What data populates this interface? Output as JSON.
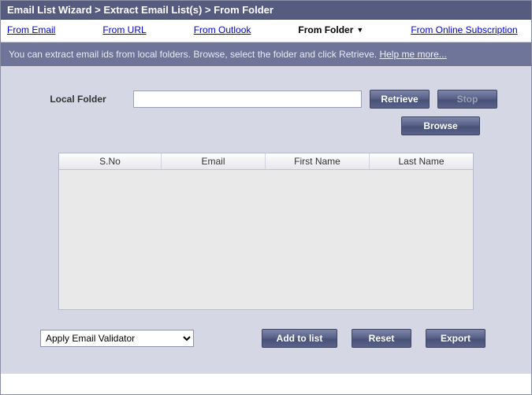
{
  "titlebar": {
    "text": "Email List Wizard > Extract Email List(s) > From Folder"
  },
  "tabs": {
    "from_email": "From Email",
    "from_url": "From URL",
    "from_outlook": "From Outlook",
    "from_folder": "From Folder",
    "from_online": "From Online Subscription"
  },
  "infobar": {
    "text": "You can extract email ids from local folders. Browse, select the folder and click Retrieve. ",
    "help": "Help me more..."
  },
  "form": {
    "local_folder_label": "Local Folder",
    "path_value": "",
    "retrieve": "Retrieve",
    "stop": "Stop",
    "browse": "Browse"
  },
  "table": {
    "headers": {
      "sno": "S.No",
      "email": "Email",
      "first_name": "First Name",
      "last_name": "Last Name"
    },
    "rows": []
  },
  "actions": {
    "validator_selected": "Apply Email Validator",
    "add_to_list": "Add to list",
    "reset": "Reset",
    "export": "Export"
  }
}
